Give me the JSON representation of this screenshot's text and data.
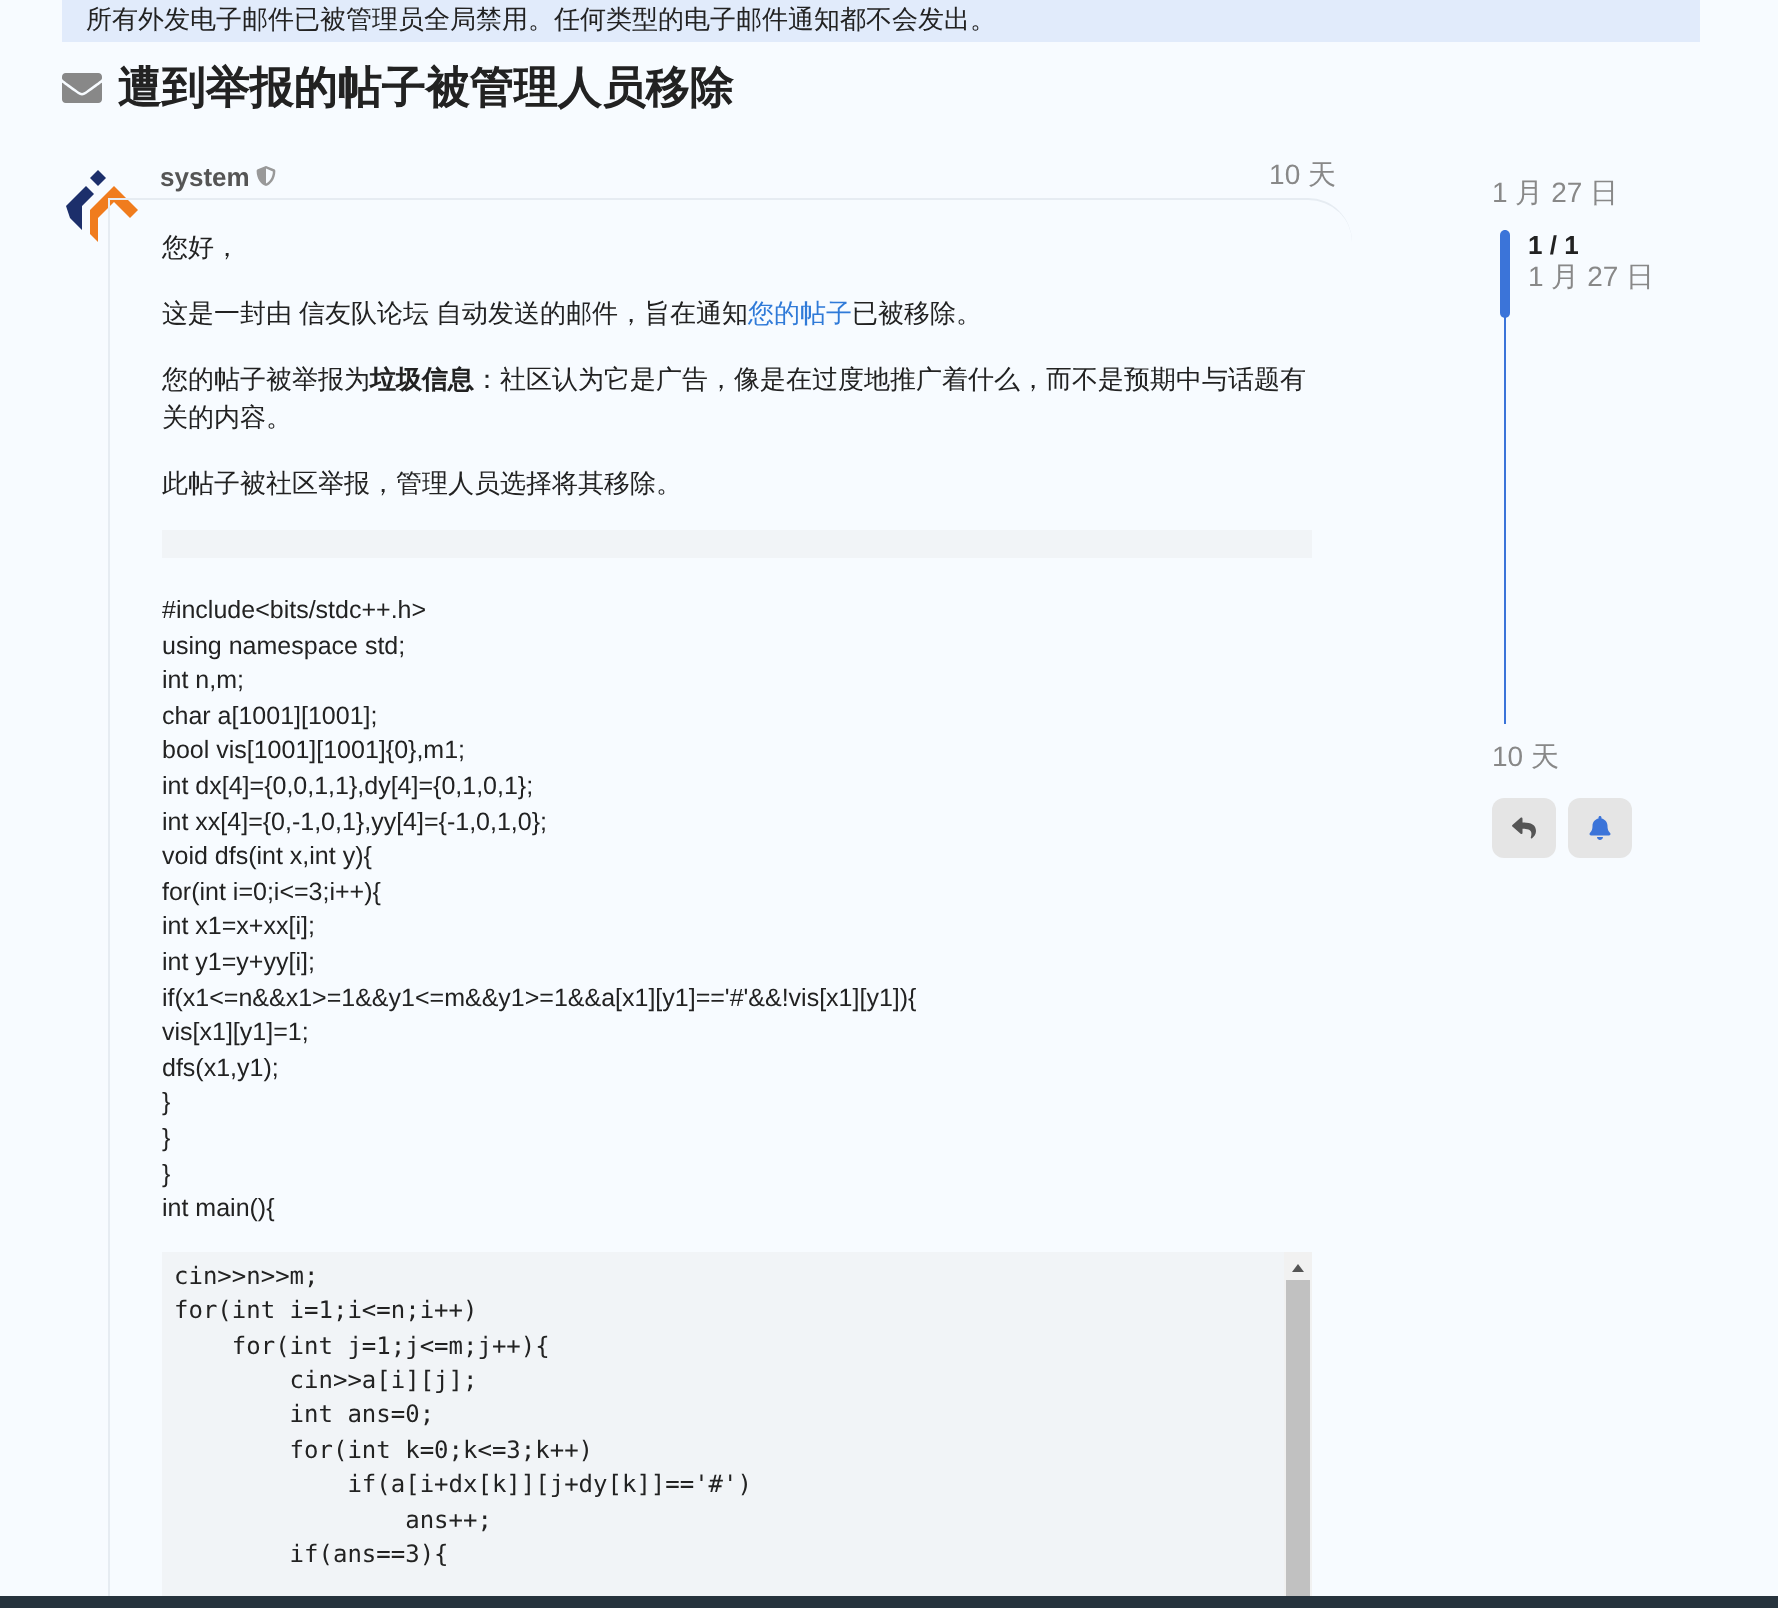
{
  "banner": "所有外发电子邮件已被管理员全局禁用。任何类型的电子邮件通知都不会发出。",
  "title": "遭到举报的帖子被管理人员移除",
  "post": {
    "username": "system",
    "age": "10 天",
    "greeting": "您好，",
    "intro": {
      "before": "这是一封由 信友队论坛 自动发送的邮件，旨在通知",
      "link": "您的帖子",
      "after": "已被移除。"
    },
    "paragraphs": [
      "您的帖子被举报为**垃圾信息**：社区认为它是广告，像是在过度地推广着什么，而不是预期中与话题有关的内容。",
      "此帖子被社区举报，管理人员选择将其移除。"
    ],
    "plain_code": [
      "#include<bits/stdc++.h>",
      "using namespace std;",
      "int n,m;",
      "char a[1001][1001];",
      "bool vis[1001][1001]{0},m1;",
      "int dx[4]={0,0,1,1},dy[4]={0,1,0,1};",
      "int xx[4]={0,-1,0,1},yy[4]={-1,0,1,0};",
      "void dfs(int x,int y){",
      "for(int i=0;i<=3;i++){",
      "int x1=x+xx[i];",
      "int y1=y+yy[i];",
      "if(x1<=n&&x1>=1&&y1<=m&&y1>=1&&a[x1][y1]=='#'&&!vis[x1][y1]){",
      "vis[x1][y1]=1;",
      "dfs(x1,y1);",
      "}",
      "}",
      "}",
      "int main(){"
    ],
    "code_block": [
      "cin>>n>>m;",
      "for(int i=1;i<=n;i++)",
      "    for(int j=1;j<=m;j++){",
      "        cin>>a[i][j];",
      "        int ans=0;",
      "        for(int k=0;k<=3;k++)",
      "            if(a[i+dx[k]][j+dy[k]]=='#')",
      "                ans++;",
      "        if(ans==3){"
    ]
  },
  "timeline": {
    "start": "1 月 27 日",
    "position": "1 / 1",
    "position_date": "1 月 27 日",
    "end": "10 天"
  }
}
